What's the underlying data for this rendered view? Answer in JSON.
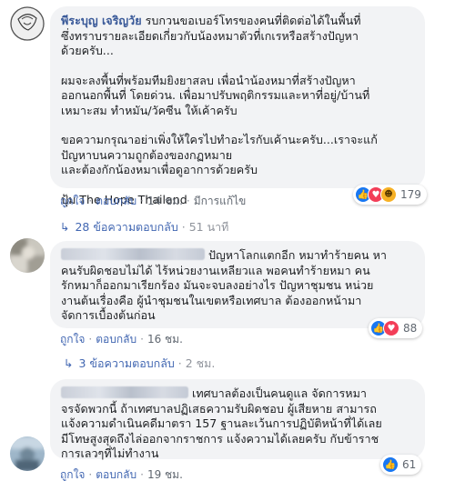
{
  "comments": [
    {
      "author": "พีระบุญ เจริญวัย",
      "paragraphs": [
        "รบกวนขอเบอร์โทรของคนที่ติดต่อได้ในพื้นที่\nซึ่งทราบรายละเอียดเกี่ยวกับน้องหมาตัวที่เกเรหรือสร้างปัญหา\nด้วยครับ...",
        "ผมจะลงพื้นที่พร้อมทีมยิงยาสลบ เพื่อนำน้องหมาที่สร้างปัญหา\nออกนอกพื้นที่ โดยด่วน. เพื่อมาปรับพฤติกรรมและหาที่อยู่/บ้านที่\nเหมาะสม ทำหมัน/วัคซีน ให้เค้าครับ",
        "ขอความกรุณาอย่าเพิ่งให้ใครไปทำอะไรกับเค้านะครับ...เราจะแก้\nปัญหาบนความถูกต้องของกฏหมาย\nและต้องกักน้องหมาเพื่อดูอาการด้วยครับ",
        "ปุ้ม The Hope Thailand"
      ],
      "actions": {
        "like": "ถูกใจ",
        "reply": "ตอบกลับ",
        "time": "14 ชม.",
        "edited": "มีการแก้ไข"
      },
      "reactions": {
        "icons": [
          "like-icon",
          "love-icon",
          "haha-icon"
        ],
        "count": "179"
      },
      "replies": {
        "label": "28 ข้อความตอบกลับ",
        "time": "51 นาที"
      }
    },
    {
      "author": "",
      "text": "ปัญหาโลกแตกอีก หมาทำร้ายคน หา\nคนรับผิดชอบไม่ได้ ไร้หน่วยงานเหลียวแล พอคนทำร้ายหมา คน\nรักหมาก็ออกมาเรียกร้อง มันจะจบลงอย่างไร ปัญหาชุมชน หน่วย\nงานต้นเรื่องคือ ผู้นำชุมชนในเขตหรือเทศบาล ต้องออกหน้ามา\nจัดการเบื้องต้นก่อน",
      "actions": {
        "like": "ถูกใจ",
        "reply": "ตอบกลับ",
        "time": "16 ชม."
      },
      "reactions": {
        "icons": [
          "like-icon",
          "love-icon"
        ],
        "count": "88"
      },
      "replies": {
        "label": "3 ข้อความตอบกลับ",
        "time": "2 ชม."
      }
    },
    {
      "author": "",
      "text": "เทศบาลต้องเป็นคนดูแล จัดการหมา\nจรจัดพวกนี้ ถ้าเทศบาลปฏิเสธความรับผิดชอบ ผู้เสียหาย สามารถ\nแจ้งความดำเนินคดีมาตรา 157 ฐานละเว้นการปฏิบัติหน้าที่ได้เลย\nมีโทษสูงสุดถึงไล่ออกจากราชการ แจ้งความได้เลยครับ กับข้าราช\nการเลวๆที่ไม่ทำงาน",
      "actions": {
        "like": "ถูกใจ",
        "reply": "ตอบกลับ",
        "time": "19 ชม."
      },
      "reactions": {
        "icons": [
          "like-icon"
        ],
        "count": "61"
      }
    }
  ]
}
